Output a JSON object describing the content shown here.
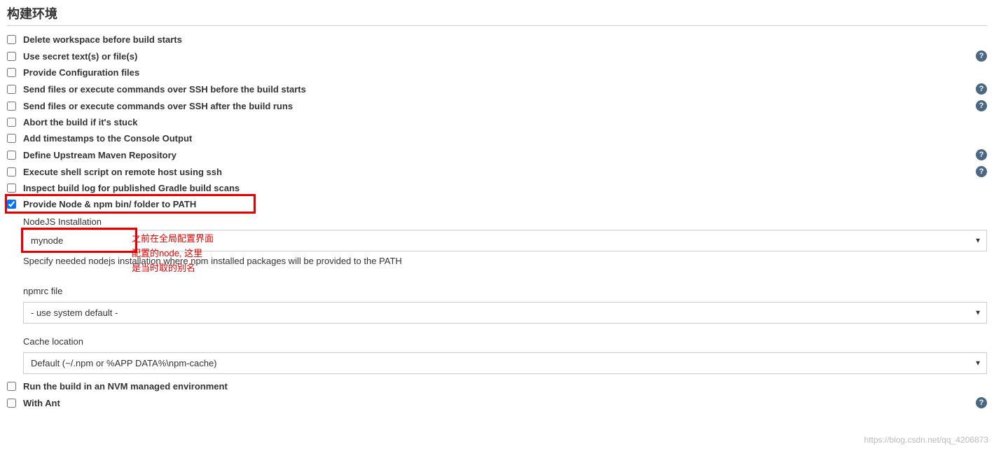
{
  "section_title": "构建环境",
  "options": {
    "delete_workspace": "Delete workspace before build starts",
    "use_secret": "Use secret text(s) or file(s)",
    "provide_config": "Provide Configuration files",
    "ssh_before": "Send files or execute commands over SSH before the build starts",
    "ssh_after": "Send files or execute commands over SSH after the build runs",
    "abort_stuck": "Abort the build if it's stuck",
    "add_timestamps": "Add timestamps to the Console Output",
    "define_upstream": "Define Upstream Maven Repository",
    "execute_shell_ssh": "Execute shell script on remote host using ssh",
    "inspect_gradle": "Inspect build log for published Gradle build scans",
    "provide_node": "Provide Node & npm bin/ folder to PATH",
    "run_nvm": "Run the build in an NVM managed environment",
    "with_ant": "With Ant"
  },
  "node_section": {
    "installation_label": "NodeJS Installation",
    "installation_value": "mynode",
    "installation_hint": "Specify needed nodejs installation where npm installed packages will be provided to the PATH",
    "npmrc_label": "npmrc file",
    "npmrc_value": "- use system default -",
    "cache_label": "Cache location",
    "cache_value": "Default (~/.npm or %APP DATA%\\npm-cache)"
  },
  "annotation": {
    "line1": "之前在全局配置界面",
    "line2": "配置的node, 这里",
    "line3": "是当时取的别名"
  },
  "help_glyph": "?",
  "watermark": "https://blog.csdn.net/qq_4206873"
}
